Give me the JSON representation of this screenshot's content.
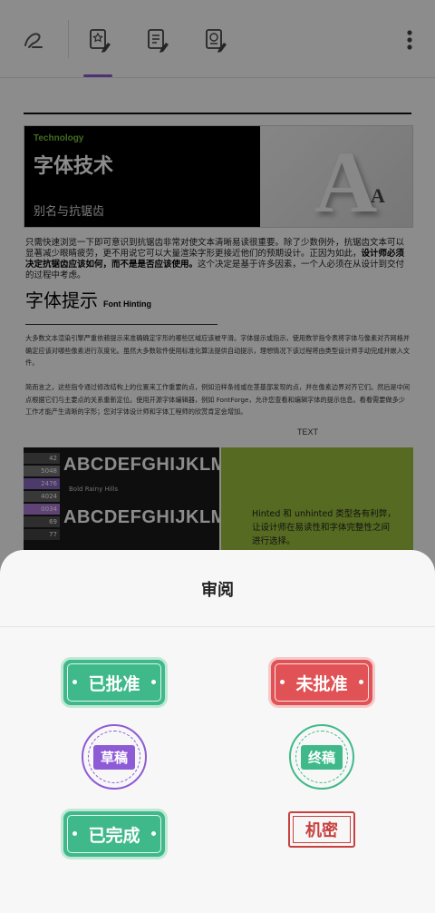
{
  "toolbar": {
    "icons": [
      "eraser-icon",
      "star-doc-icon",
      "edit-doc-icon",
      "badge-doc-icon"
    ],
    "more_icon": "more-vertical-icon",
    "accent": "#8e5bd6"
  },
  "document": {
    "banner": {
      "tag": "Technology",
      "title": "字体技术",
      "subtitle": "别名与抗锯齿"
    },
    "para1_normal": "只需快速浏览一下即可意识到抗锯齿非常对使文本清晰易读很重要。除了少数例外，抗锯齿文本可以显著减少眼睛疲劳，更不用说它可以大量渲染字形更接近他们的预期设计。正因为如此，",
    "para1_bold": "设计师必须决定抗锯齿应该如何，而不是是否应该使用。",
    "para1_tail": "这个决定是基于许多因素，一个人必须在从设计到交付的过程中考虑。",
    "heading": "字体提示",
    "heading_en": "Font Hinting",
    "para2": "大多数文本渲染引擎严重依赖提示来准确确定字形的哪些区域应该被平滑。字体提示或指示，使用数学指令表将字体与像素对齐网格并确定应该对哪些像素进行灰度化。虽然大多数软件使用标准化算法提供自动提示，理想情况下该过程将由类型设计师手动完成并嵌入文件。",
    "para3": "简而言之，这些指令通过修改结构上的位置来工作重要的点，例如沿样条线或在茎基部发现的点，并在像素边界对齐它们。然后是中间点根据它们与主要点的关系重新定位。使用开源字体编辑器，例如 FontForge，允许您查看和编辑字体的提示信息。看看需要做多少工作才能产生清晰的字形；您对字体设计师和字体工程师的欣赏肯定会增加。",
    "text_label": "TEXT",
    "image_rows": [
      "ABCDEFGHIJKLMNO",
      "ABCDEFGHIJKLMNO"
    ],
    "image_strip": [
      "42",
      "5048",
      "2476",
      "4024",
      "0034",
      "69",
      "77"
    ],
    "image_caption": "Bold Rainy Hills",
    "green_text": "Hinted 和 unhinted 类型各有利弊，让设计师在易读性和字体完整性之间进行选择。"
  },
  "sheet": {
    "title": "审阅",
    "stamps": {
      "approved": "已批准",
      "rejected": "未批准",
      "draft": "草稿",
      "final": "终稿",
      "completed": "已完成",
      "confidential": "机密"
    },
    "colors": {
      "green": "#3fb98a",
      "red": "#e05255",
      "purple": "#8e5bd6",
      "secret_red": "#c8413f"
    }
  }
}
